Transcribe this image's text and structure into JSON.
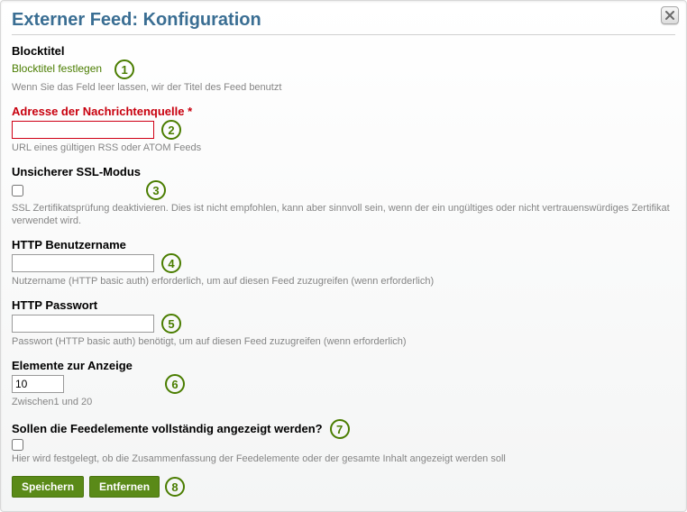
{
  "dialog": {
    "title": "Externer Feed: Konfiguration",
    "close_label": "Close"
  },
  "fields": {
    "blocktitle": {
      "label": "Blocktitel",
      "link": "Blocktitel festlegen",
      "help": "Wenn Sie das Feld leer lassen, wir der Titel des Feed benutzt"
    },
    "url": {
      "label": "Adresse der Nachrichtenquelle",
      "asterisk": "*",
      "value": "",
      "help": "URL eines gültigen RSS oder ATOM Feeds"
    },
    "insecure": {
      "label": "Unsicherer SSL-Modus",
      "checked": false,
      "help": "SSL Zertifikatsprüfung deaktivieren. Dies ist nicht empfohlen, kann aber sinnvoll sein, wenn der ein ungültiges oder nicht vertrauenswürdiges Zertifikat verwendet wird."
    },
    "user": {
      "label": "HTTP Benutzername",
      "value": "",
      "help": "Nutzername (HTTP basic auth) erforderlich, um auf diesen Feed zuzugreifen (wenn erforderlich)"
    },
    "pass": {
      "label": "HTTP Passwort",
      "value": "",
      "help": "Passwort (HTTP basic auth) benötigt, um auf diesen Feed zuzugreifen (wenn erforderlich)"
    },
    "count": {
      "label": "Elemente zur Anzeige",
      "value": "10",
      "help": "Zwischen1 und 20"
    },
    "full": {
      "label": "Sollen die Feedelemente vollständig angezeigt werden?",
      "checked": false,
      "help": "Hier wird festgelegt, ob die Zusammenfassung der Feedelemente oder der gesamte Inhalt angezeigt werden soll"
    }
  },
  "buttons": {
    "save": "Speichern",
    "remove": "Entfernen"
  },
  "markers": {
    "m1": "1",
    "m2": "2",
    "m3": "3",
    "m4": "4",
    "m5": "5",
    "m6": "6",
    "m7": "7",
    "m8": "8"
  }
}
